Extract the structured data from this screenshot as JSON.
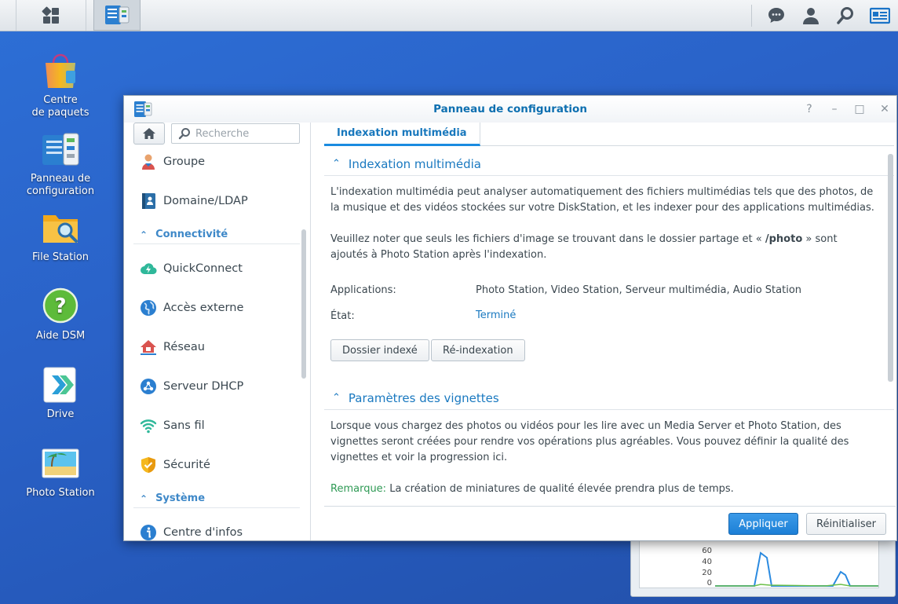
{
  "desktop": {
    "icons": [
      {
        "label_line1": "Centre",
        "label_line2": "de paquets"
      },
      {
        "label_line1": "Panneau de",
        "label_line2": "configuration"
      },
      {
        "label_line1": "File Station",
        "label_line2": ""
      },
      {
        "label_line1": "Aide DSM",
        "label_line2": ""
      },
      {
        "label_line1": "Drive",
        "label_line2": ""
      },
      {
        "label_line1": "Photo Station",
        "label_line2": ""
      }
    ]
  },
  "widget": {
    "y_ticks": [
      "60",
      "40",
      "20",
      "0"
    ]
  },
  "window": {
    "title": "Panneau de configuration",
    "controls": {
      "help": "?",
      "minimize": "–",
      "maximize": "□",
      "close": "✕"
    }
  },
  "sidebar": {
    "search_placeholder": "Recherche",
    "items": [
      {
        "label": "Groupe"
      },
      {
        "label": "Domaine/LDAP"
      },
      {
        "label": "QuickConnect"
      },
      {
        "label": "Accès externe"
      },
      {
        "label": "Réseau"
      },
      {
        "label": "Serveur DHCP"
      },
      {
        "label": "Sans fil"
      },
      {
        "label": "Sécurité"
      },
      {
        "label": "Centre d'infos"
      }
    ],
    "sections": [
      {
        "label": "Connectivité"
      },
      {
        "label": "Système"
      }
    ]
  },
  "main": {
    "tab": "Indexation multimédia",
    "section1": {
      "title": "Indexation multimédia",
      "para1": "L'indexation multimédia peut analyser automatiquement des fichiers multimédias tels que des photos, de la musique et des vidéos stockées sur votre DiskStation, et les indexer pour des applications multimédias.",
      "para2_before": "Veuillez noter que seuls les fichiers d'image se trouvant dans le dossier partage et « ",
      "para2_bold": "/photo",
      "para2_after": " » sont ajoutés à Photo Station après l'indexation.",
      "applications_label": "Applications:",
      "applications_value": "Photo Station, Video Station, Serveur multimédia, Audio Station",
      "state_label": "État:",
      "state_value": "Terminé",
      "btn_indexed": "Dossier indexé",
      "btn_reindex": "Ré-indexation"
    },
    "section2": {
      "title": "Paramètres des vignettes",
      "para1": "Lorsque vous chargez des photos ou vidéos pour les lire avec un Media Server et Photo Station, des vignettes seront créées pour rendre vos opérations plus agréables. Vous pouvez définir la qualité des vignettes et voir la progression ici.",
      "note_key": "Remarque:",
      "note_text": " La création de miniatures de qualité élevée prendra plus de temps."
    }
  },
  "footer": {
    "apply": "Appliquer",
    "reset": "Réinitialiser"
  },
  "colors": {
    "accent": "#1a79c0",
    "primary_button": "#2a8ae0",
    "note_green": "#2f9a55",
    "desktop_blue": "#2a62c8"
  }
}
